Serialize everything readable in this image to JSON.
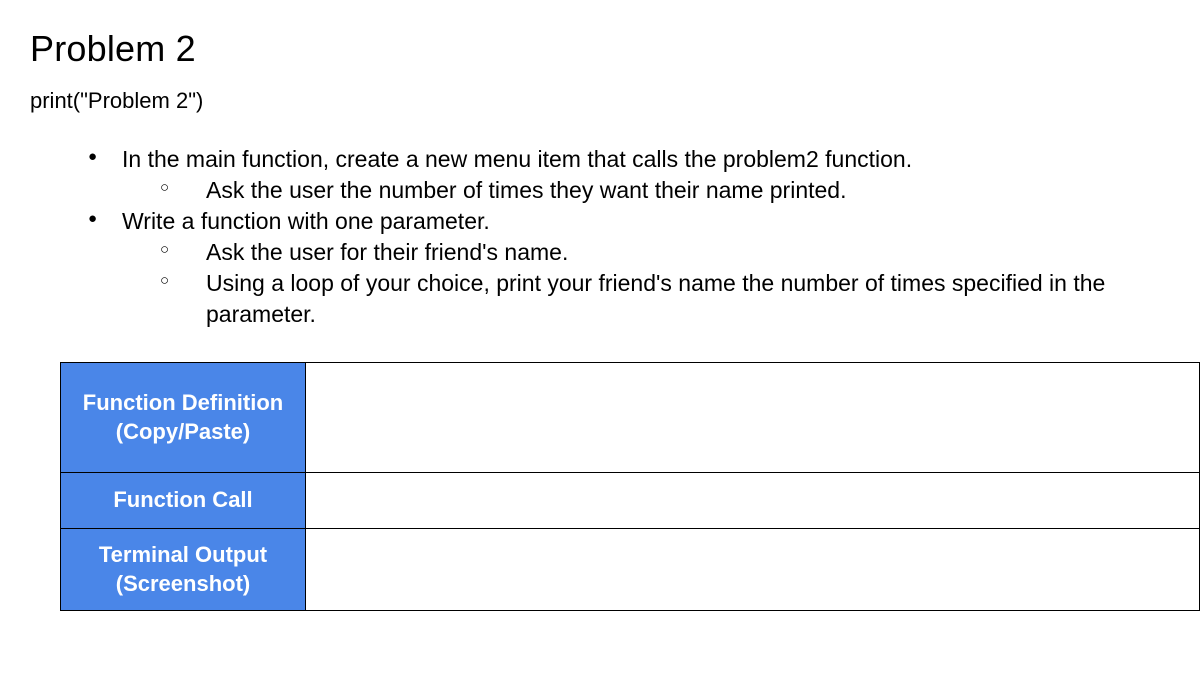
{
  "heading": "Problem 2",
  "subline": "print(\"Problem 2\")",
  "bullets": {
    "item1": "In the main function, create a new menu item that calls the problem2 function.",
    "item1_sub1": "Ask the user the number of times they want their name printed.",
    "item2": "Write a function with one parameter.",
    "item2_sub1": "Ask the user for their friend's name.",
    "item2_sub2": "Using a loop of your choice, print your friend's name the number of times specified in the parameter."
  },
  "table": {
    "row1_label": "Function Definition (Copy/Paste)",
    "row1_value": "",
    "row2_label": "Function Call",
    "row2_value": "",
    "row3_label": "Terminal Output (Screenshot)",
    "row3_value": ""
  }
}
